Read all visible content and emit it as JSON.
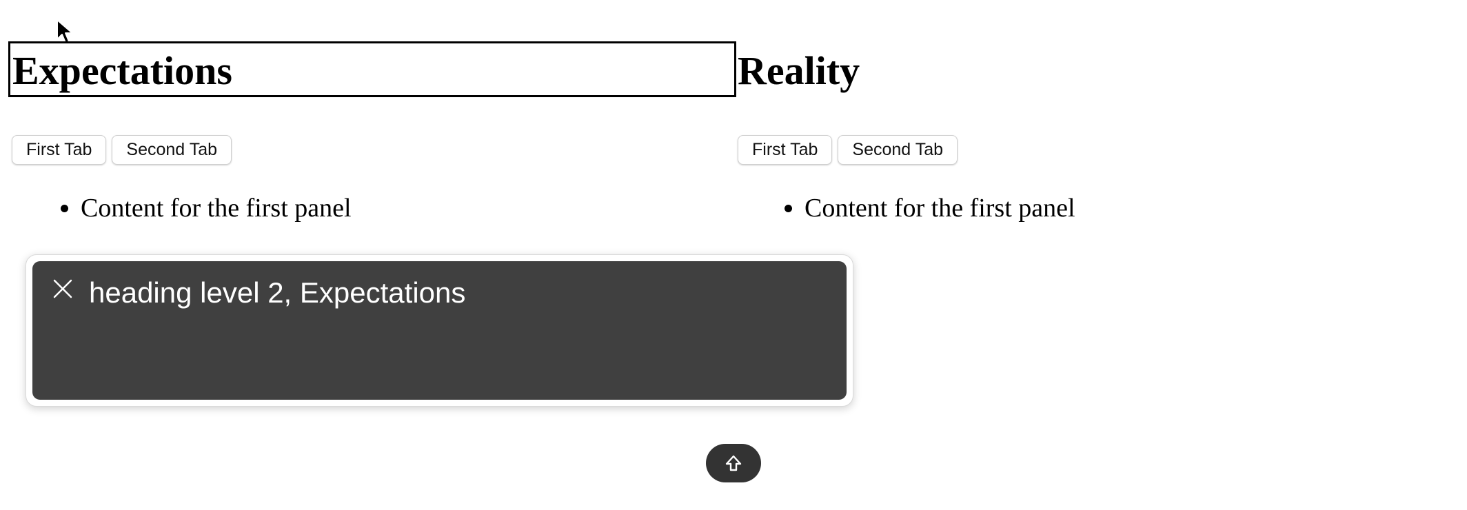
{
  "left_column": {
    "heading": "Expectations",
    "tabs": [
      {
        "label": "First Tab"
      },
      {
        "label": "Second Tab"
      }
    ],
    "panel_items": [
      "Content for the first panel"
    ]
  },
  "right_column": {
    "heading": "Reality",
    "tabs": [
      {
        "label": "First Tab"
      },
      {
        "label": "Second Tab"
      }
    ],
    "panel_items": [
      "Content for the first panel"
    ]
  },
  "screen_reader_caption": {
    "text": "heading level 2, Expectations",
    "close_icon": "close-icon"
  },
  "scroll_top_button": {
    "icon": "arrow-up-icon"
  },
  "colors": {
    "caption_background": "#404040",
    "caption_text": "#ffffff",
    "scroll_button_background": "#333333",
    "focus_ring": "#000000"
  }
}
